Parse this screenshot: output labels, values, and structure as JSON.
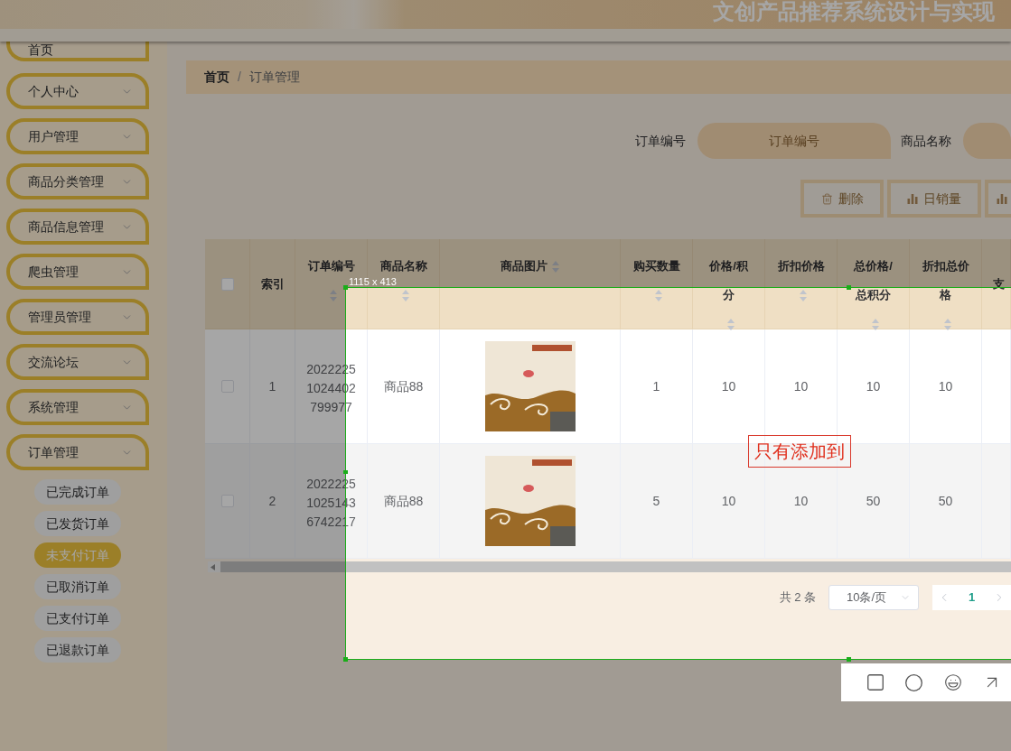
{
  "header": {
    "title": "文创产品推荐系统设计与实现"
  },
  "sidebar": {
    "items": [
      {
        "label": "首页",
        "has_submenu": false
      },
      {
        "label": "个人中心",
        "has_submenu": true
      },
      {
        "label": "用户管理",
        "has_submenu": true
      },
      {
        "label": "商品分类管理",
        "has_submenu": true
      },
      {
        "label": "商品信息管理",
        "has_submenu": true
      },
      {
        "label": "爬虫管理",
        "has_submenu": true
      },
      {
        "label": "管理员管理",
        "has_submenu": true
      },
      {
        "label": "交流论坛",
        "has_submenu": true
      },
      {
        "label": "系统管理",
        "has_submenu": true
      },
      {
        "label": "订单管理",
        "has_submenu": true,
        "children": [
          {
            "label": "已完成订单",
            "selected": false
          },
          {
            "label": "已发货订单",
            "selected": false
          },
          {
            "label": "未支付订单",
            "selected": true
          },
          {
            "label": "已取消订单",
            "selected": false
          },
          {
            "label": "已支付订单",
            "selected": false
          },
          {
            "label": "已退款订单",
            "selected": false
          }
        ]
      }
    ]
  },
  "breadcrumb": {
    "separator": "/",
    "items": [
      {
        "label": "首页",
        "current": false
      },
      {
        "label": "订单管理",
        "current": true
      }
    ]
  },
  "search": {
    "fields": [
      {
        "label": "订单编号",
        "placeholder": "订单编号"
      },
      {
        "label": "商品名称"
      }
    ]
  },
  "actions": [
    {
      "kind": "delete",
      "label": "删除"
    },
    {
      "kind": "chart",
      "label": "日销量"
    },
    {
      "kind": "chart"
    }
  ],
  "table": {
    "select_all_checked": false,
    "columns": [
      {
        "label": "索引",
        "sortable": false
      },
      {
        "label": "订单编号",
        "sortable": true
      },
      {
        "label": "商品名称",
        "sortable": true
      },
      {
        "label": "商品图片",
        "sortable": true
      },
      {
        "label": "购买数量",
        "sortable": true
      },
      {
        "label": "价格/积分",
        "sortable": true
      },
      {
        "label": "折扣价格",
        "sortable": true
      },
      {
        "label": "总价格/总积分",
        "sortable": true
      },
      {
        "label": "折扣总价格",
        "sortable": true
      },
      {
        "label": "支",
        "sortable": false
      }
    ],
    "rows": [
      {
        "checked": false,
        "cells": [
          {
            "kind": "text",
            "text": "1"
          },
          {
            "kind": "order_no",
            "text": "20222251024402799977"
          },
          {
            "kind": "text",
            "text": "商品88"
          },
          {
            "kind": "image"
          },
          {
            "kind": "text",
            "text": "1"
          },
          {
            "kind": "text",
            "text": "10"
          },
          {
            "kind": "text",
            "text": "10"
          },
          {
            "kind": "text",
            "text": "10"
          },
          {
            "kind": "text",
            "text": "10"
          }
        ]
      },
      {
        "checked": false,
        "cells": [
          {
            "kind": "text",
            "text": "2"
          },
          {
            "kind": "order_no",
            "text": "202222510251436742217"
          },
          {
            "kind": "text",
            "text": "商品88"
          },
          {
            "kind": "image"
          },
          {
            "kind": "text",
            "text": "5"
          },
          {
            "kind": "text",
            "text": "10"
          },
          {
            "kind": "text",
            "text": "10"
          },
          {
            "kind": "text",
            "text": "50"
          },
          {
            "kind": "text",
            "text": "50"
          }
        ]
      }
    ]
  },
  "pagination": {
    "total": "共 2 条",
    "page_size": "10条/页",
    "pages": [
      {
        "label": "1",
        "selected": true
      }
    ]
  },
  "capture": {
    "size_label": "1115 x 413",
    "annotation": "只有添加到"
  }
}
